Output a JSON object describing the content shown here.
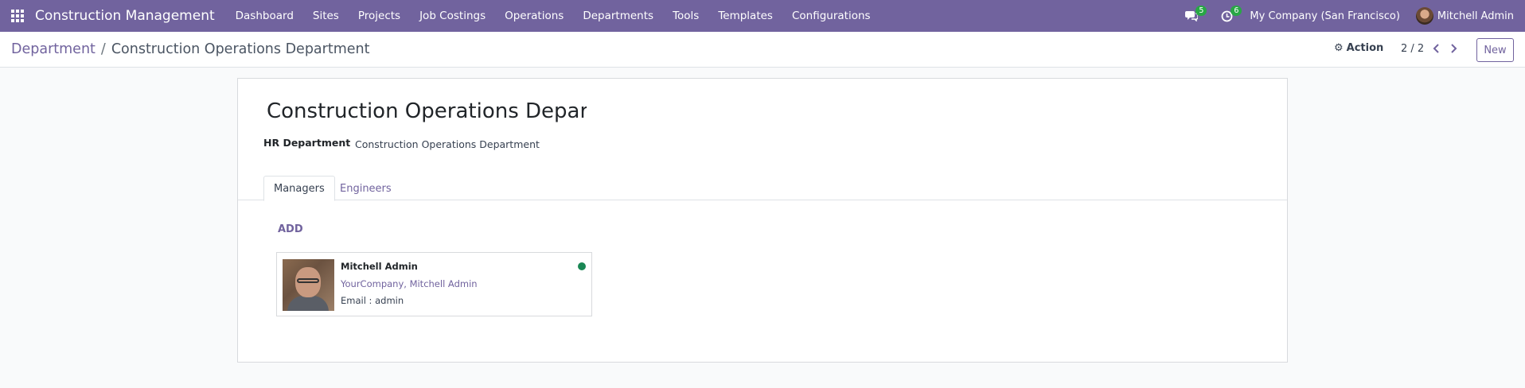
{
  "navbar": {
    "brand": "Construction Management",
    "menu": [
      "Dashboard",
      "Sites",
      "Projects",
      "Job Costings",
      "Operations",
      "Departments",
      "Tools",
      "Templates",
      "Configurations"
    ],
    "messages_badge": "5",
    "activities_badge": "6",
    "company": "My Company (San Francisco)",
    "user": "Mitchell Admin"
  },
  "control_panel": {
    "breadcrumb_parent": "Department",
    "breadcrumb_separator": "/",
    "breadcrumb_current": "Construction Operations Department",
    "action_label": "Action",
    "pager_value": "2 / 2",
    "new_label": "New"
  },
  "form": {
    "name": "Construction Operations Department",
    "hr_department_label": "HR Department",
    "hr_department_value": "Construction Operations Department",
    "tabs": [
      "Managers",
      "Engineers"
    ],
    "active_tab": "Managers",
    "add_label": "ADD",
    "manager_card": {
      "name": "Mitchell Admin",
      "company": "YourCompany, Mitchell Admin",
      "email": "Email : admin",
      "presence_color": "#198754"
    }
  },
  "colors": {
    "navbar": "#71639e",
    "accent": "#71639e"
  }
}
